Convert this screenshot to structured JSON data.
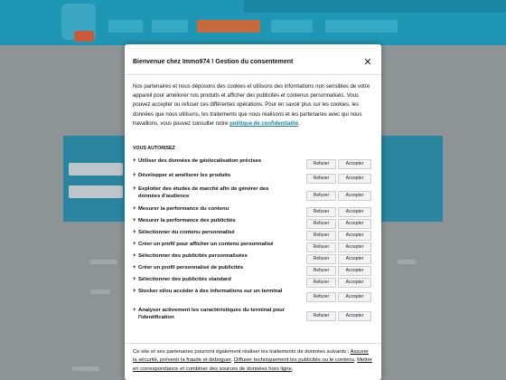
{
  "modal": {
    "title": "Bienvenue chez Immo974 ! Gestion du consentement",
    "intro_text": "Nos partenaires et nous déposons des cookies et utilisons des informations non sensibles de votre appareil pour améliorer nos produits et afficher des publicités et contenus personnalisés. Vous pouvez accepter ou refuser ces différentes opérations. Pour en savoir plus sur les cookies, les données que nous utilisons, les traitements que nous réalisons et les partenaires avec qui nous travaillons, vous pouvez consulter notre ",
    "policy_link": "politique de confidentialité",
    "intro_end": ".",
    "section_title": "VOUS AUTORISEZ",
    "refuse_label": "Refuser",
    "accept_label": "Accepter",
    "purposes": [
      {
        "label": "Utiliser des données de géolocalisation précises"
      },
      {
        "label": "Développer et améliorer les produits"
      },
      {
        "label": "Exploiter des études de marché afin de générer des données d'audience"
      },
      {
        "label": "Mesurer la performance du contenu"
      },
      {
        "label": "Mesurer la performance des publicités"
      },
      {
        "label": "Sélectionner du contenu personnalisé"
      },
      {
        "label": "Créer un profil pour afficher un contenu personnalisé"
      },
      {
        "label": "Sélectionner des publicités personnalisées"
      },
      {
        "label": "Créer un profil personnalisé de publicités"
      },
      {
        "label": "Sélectionner des publicités standard"
      },
      {
        "label": "Stocker et/ou accéder à des informations sur un terminal"
      },
      {
        "label": "Analyser activement les caractéristiques du terminal pour l'identification"
      }
    ],
    "footer_intro": "Ce site et ses partenaires pourront également réaliser les traitements de données suivants : ",
    "footer_items": [
      "Assurer la sécurité, prévenir la fraude et déboguer",
      "Diffuser techniquement les publicités ou le contenu",
      "Mettre en correspondance et combiner des sources de données hors ligne"
    ],
    "footer_sep": ", ",
    "footer_end": ","
  }
}
